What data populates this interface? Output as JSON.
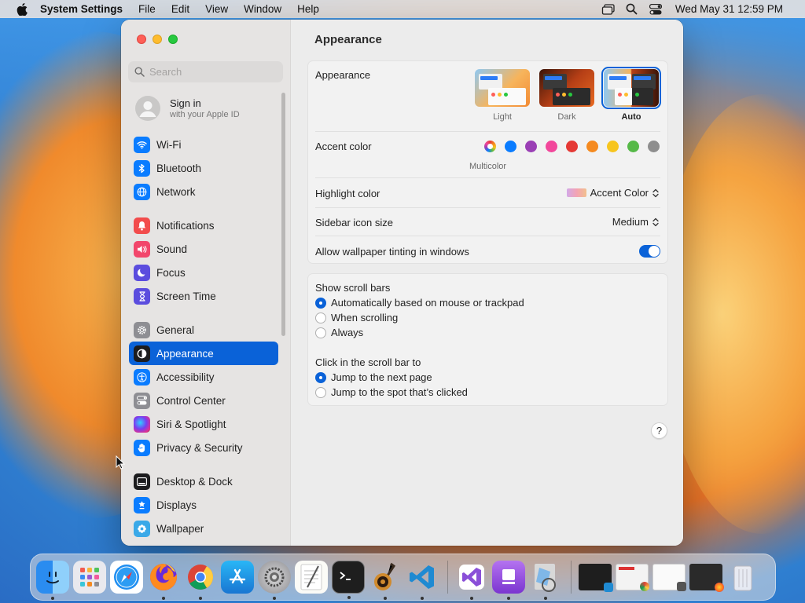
{
  "menubar": {
    "app_name": "System Settings",
    "menus": [
      "File",
      "Edit",
      "View",
      "Window",
      "Help"
    ],
    "clock": "Wed May 31  12:59 PM"
  },
  "window": {
    "title": "Appearance",
    "search": {
      "placeholder": "Search"
    },
    "signin": {
      "title": "Sign in",
      "subtitle": "with your Apple ID"
    },
    "sidebar_groups": [
      [
        {
          "label": "Wi-Fi",
          "icon": "wifi-icon",
          "color": "#0a7cff"
        },
        {
          "label": "Bluetooth",
          "icon": "bluetooth-icon",
          "color": "#0a7cff"
        },
        {
          "label": "Network",
          "icon": "globe-icon",
          "color": "#0a7cff"
        }
      ],
      [
        {
          "label": "Notifications",
          "icon": "bell-icon",
          "color": "#f24c4c"
        },
        {
          "label": "Sound",
          "icon": "speaker-icon",
          "color": "#f2466b"
        },
        {
          "label": "Focus",
          "icon": "moon-icon",
          "color": "#5b4dde"
        },
        {
          "label": "Screen Time",
          "icon": "hourglass-icon",
          "color": "#5b4dde"
        }
      ],
      [
        {
          "label": "General",
          "icon": "gear-icon",
          "color": "#8e8e93"
        },
        {
          "label": "Appearance",
          "icon": "appearance-icon",
          "color": "#1c1c1e",
          "selected": true
        },
        {
          "label": "Accessibility",
          "icon": "accessibility-icon",
          "color": "#0a7cff"
        },
        {
          "label": "Control Center",
          "icon": "control-center-icon",
          "color": "#8e8e93"
        },
        {
          "label": "Siri & Spotlight",
          "icon": "siri-icon",
          "color": "#b03fc4"
        },
        {
          "label": "Privacy & Security",
          "icon": "hand-icon",
          "color": "#0a7cff"
        }
      ],
      [
        {
          "label": "Desktop & Dock",
          "icon": "dock-icon",
          "color": "#1c1c1e"
        },
        {
          "label": "Displays",
          "icon": "display-icon",
          "color": "#0a7cff"
        },
        {
          "label": "Wallpaper",
          "icon": "wallpaper-icon",
          "color": "#3aa9e8"
        }
      ]
    ]
  },
  "appearance": {
    "label": "Appearance",
    "options": [
      {
        "label": "Light",
        "selected": false
      },
      {
        "label": "Dark",
        "selected": false
      },
      {
        "label": "Auto",
        "selected": true
      }
    ],
    "accent_label": "Accent color",
    "accent_colors": [
      "multicolor",
      "#0a7cff",
      "#9a3fb5",
      "#f2479b",
      "#e53935",
      "#f58a1f",
      "#f7c51e",
      "#56b948",
      "#8e8e8e"
    ],
    "accent_selected_name": "Multicolor",
    "highlight_label": "Highlight color",
    "highlight_value": "Accent Color",
    "icon_size_label": "Sidebar icon size",
    "icon_size_value": "Medium",
    "tinting_label": "Allow wallpaper tinting in windows",
    "tinting_on": true
  },
  "scroll": {
    "show_label": "Show scroll bars",
    "show_options": [
      {
        "label": "Automatically based on mouse or trackpad",
        "checked": true
      },
      {
        "label": "When scrolling",
        "checked": false
      },
      {
        "label": "Always",
        "checked": false
      }
    ],
    "click_label": "Click in the scroll bar to",
    "click_options": [
      {
        "label": "Jump to the next page",
        "checked": true
      },
      {
        "label": "Jump to the spot that’s clicked",
        "checked": false
      }
    ]
  },
  "help_label": "?",
  "dock": {
    "apps": [
      "Finder",
      "Launchpad",
      "Safari",
      "Firefox",
      "Google Chrome",
      "App Store",
      "System Settings",
      "TextEdit",
      "Terminal",
      "GarageBand",
      "Visual Studio Code"
    ],
    "extra_apps": [
      "Visual Studio",
      "Podcasts",
      "Preview"
    ],
    "minimized": [
      "Code window",
      "Chrome window",
      "Notes window",
      "Firefox window"
    ],
    "trash": "Trash"
  }
}
